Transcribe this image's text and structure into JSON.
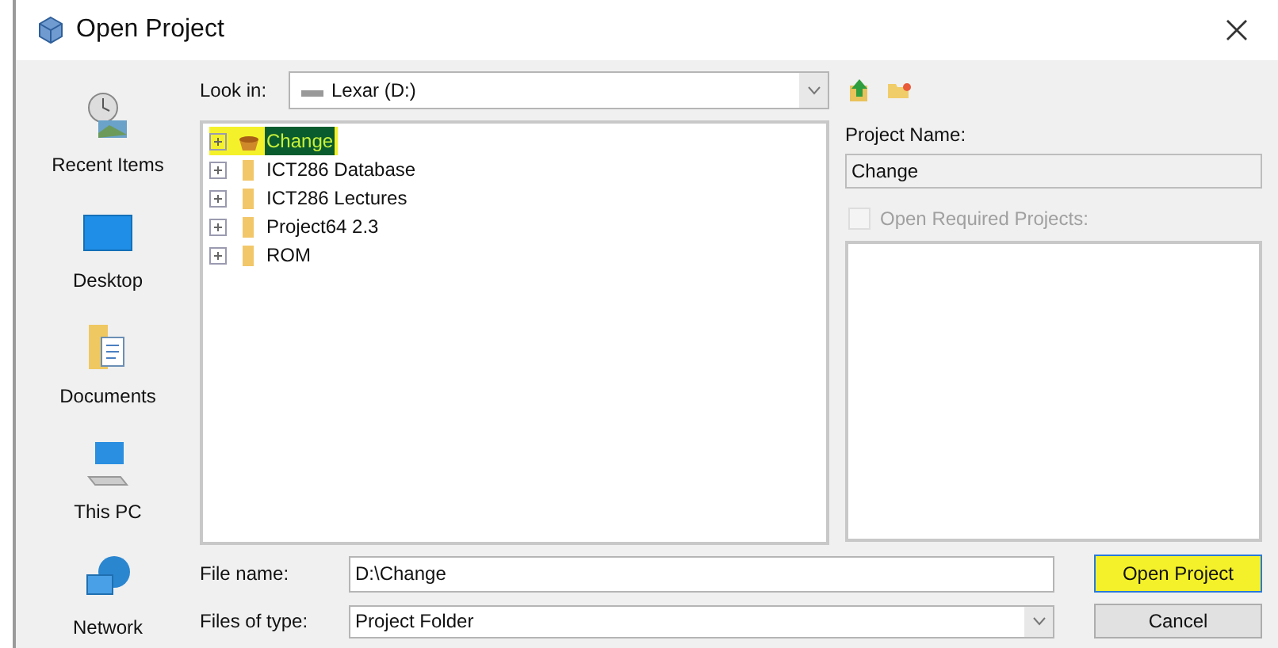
{
  "window": {
    "title": "Open Project"
  },
  "sidebar": {
    "items": [
      {
        "kind": "recent",
        "label": "Recent Items"
      },
      {
        "kind": "desktop",
        "label": "Desktop"
      },
      {
        "kind": "documents",
        "label": "Documents"
      },
      {
        "kind": "pc",
        "label": "This PC"
      },
      {
        "kind": "network",
        "label": "Network"
      }
    ]
  },
  "look_in": {
    "label": "Look in:",
    "value": "Lexar (D:)"
  },
  "tree": {
    "items": [
      {
        "kind": "project",
        "label": "Change",
        "selected": true,
        "highlighted": true
      },
      {
        "kind": "folder",
        "label": "ICT286 Database",
        "selected": false,
        "highlighted": false
      },
      {
        "kind": "folder",
        "label": "ICT286 Lectures",
        "selected": false,
        "highlighted": false
      },
      {
        "kind": "folder",
        "label": "Project64 2.3",
        "selected": false,
        "highlighted": false
      },
      {
        "kind": "folder",
        "label": "ROM",
        "selected": false,
        "highlighted": false
      }
    ]
  },
  "project_name": {
    "label": "Project Name:",
    "value": "Change"
  },
  "open_required": {
    "label": "Open Required Projects:",
    "checked": false,
    "disabled": true
  },
  "file_name": {
    "label": "File name:",
    "value": "D:\\Change"
  },
  "files_of_type": {
    "label": "Files of type:",
    "value": "Project Folder"
  },
  "buttons": [
    {
      "label": "Open Project",
      "default": true,
      "highlighted": true
    },
    {
      "label": "Cancel",
      "default": false,
      "highlighted": false
    }
  ]
}
